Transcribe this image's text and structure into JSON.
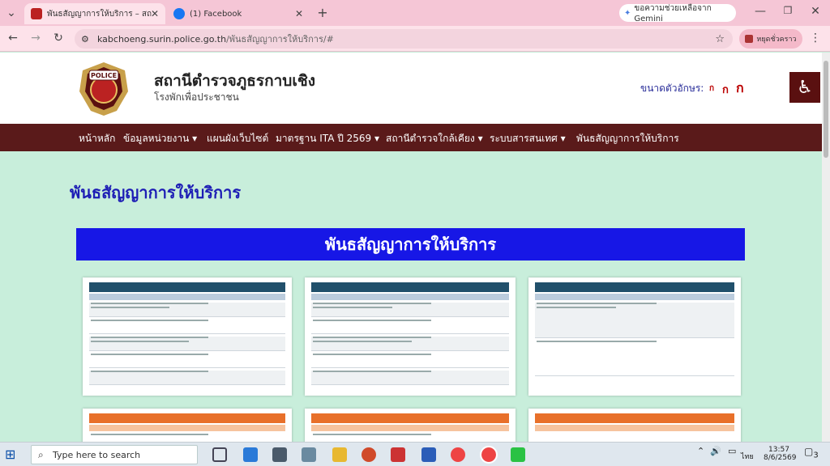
{
  "browser": {
    "tabs": [
      {
        "title": "พันธสัญญาการให้บริการ – สถานีตำร",
        "active": true
      },
      {
        "title": "(1) Facebook",
        "active": false
      }
    ],
    "new_tab": "+",
    "gemini": "ขอความช่วยเหลือจาก Gemini",
    "url_host": "kabchoeng.surin.police.go.th",
    "url_path": "/พันธสัญญาการให้บริการ/#",
    "profile": "หยุดชั่วคราว"
  },
  "site": {
    "logo_text": "POLICE",
    "title": "สถานีตำรวจภูธรกาบเชิง",
    "subtitle": "โรงพักเพื่อประชาชน",
    "font_size_label": "ขนาดตัวอักษร:",
    "font_sizes": [
      "ก",
      "ก",
      "ก"
    ]
  },
  "menu": [
    "หน้าหลัก",
    "ข้อมูลหน่วยงาน ▾",
    "แผนผังเว็บไซต์",
    "มาตรฐาน ITA ปี 2569 ▾",
    "สถานีตำรวจใกล้เคียง ▾",
    "ระบบสารสนเทศ ▾",
    "พันธสัญญาการให้บริการ"
  ],
  "page": {
    "heading": "พันธสัญญาการให้บริการ",
    "banner": "พันธสัญญาการให้บริการ"
  },
  "taskbar": {
    "search_placeholder": "Type here to search",
    "lang": "ไทย",
    "time": "13:57",
    "date": "8/6/2569",
    "notif_count": "3"
  },
  "colors": {
    "menubar": "#5a1a1a",
    "banner": "#1717e6",
    "page_bg": "#c8eedb"
  }
}
